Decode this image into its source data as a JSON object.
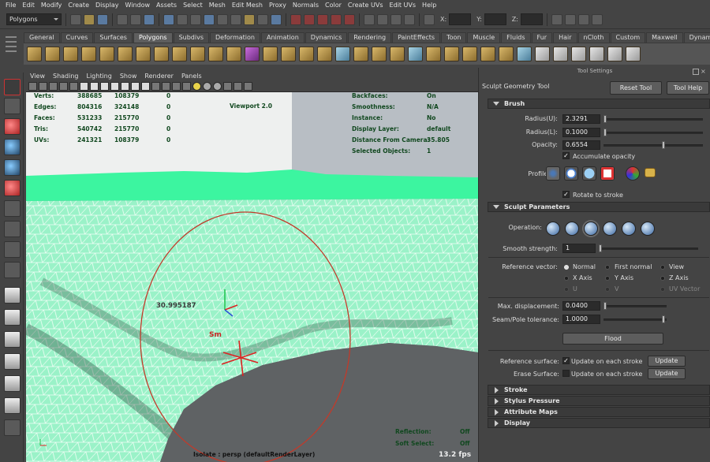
{
  "menubar": {
    "items": [
      "File",
      "Edit",
      "Modify",
      "Create",
      "Display",
      "Window",
      "Assets",
      "Select",
      "Mesh",
      "Edit Mesh",
      "Proxy",
      "Normals",
      "Color",
      "Create UVs",
      "Edit UVs",
      "Help"
    ]
  },
  "status_line": {
    "mode": "Polygons",
    "x_label": "X:",
    "y_label": "Y:",
    "z_label": "Z:"
  },
  "shelf": {
    "tabs": [
      "General",
      "Curves",
      "Surfaces",
      "Polygons",
      "Subdivs",
      "Deformation",
      "Animation",
      "Dynamics",
      "Rendering",
      "PaintEffects",
      "Toon",
      "Muscle",
      "Fluids",
      "Fur",
      "Hair",
      "nCloth",
      "Custom",
      "Maxwell",
      "Dynamica"
    ],
    "active_tab": "Polygons"
  },
  "viewport": {
    "menu": [
      "View",
      "Shading",
      "Lighting",
      "Show",
      "Renderer",
      "Panels"
    ],
    "hud_stats": [
      {
        "label": "Verts:",
        "v1": "388685",
        "v2": "108379",
        "v3": "0"
      },
      {
        "label": "Edges:",
        "v1": "804316",
        "v2": "324148",
        "v3": "0"
      },
      {
        "label": "Faces:",
        "v1": "531233",
        "v2": "215770",
        "v3": "0"
      },
      {
        "label": "Tris:",
        "v1": "540742",
        "v2": "215770",
        "v3": "0"
      },
      {
        "label": "UVs:",
        "v1": "241321",
        "v2": "108379",
        "v3": "0"
      }
    ],
    "renderer_label": "Viewport 2.0",
    "hud_right": [
      {
        "label": "Backfaces:",
        "value": "On"
      },
      {
        "label": "Smoothness:",
        "value": "N/A"
      },
      {
        "label": "Instance:",
        "value": "No"
      },
      {
        "label": "Display Layer:",
        "value": "default"
      },
      {
        "label": "Distance From Camera:",
        "value": "35.805"
      },
      {
        "label": "Selected Objects:",
        "value": "1"
      }
    ],
    "brush_value": "30.995187",
    "sm_label": "Sm",
    "hud_bottom": [
      {
        "label": "Reflection:",
        "value": "Off"
      },
      {
        "label": "Soft Select:",
        "value": "Off"
      }
    ],
    "isolate_label": "Isolate : persp (defaultRenderLayer)",
    "fps": "13.2 fps"
  },
  "tool_settings": {
    "panel_title": "Tool Settings",
    "tool_name": "Sculpt Geometry Tool",
    "reset_button": "Reset Tool",
    "help_button": "Tool Help",
    "brush_section": "Brush",
    "radius_u_label": "Radius(U):",
    "radius_u": "2.3291",
    "radius_l_label": "Radius(L):",
    "radius_l": "0.1000",
    "opacity_label": "Opacity:",
    "opacity": "0.6554",
    "accumulate_label": "Accumulate opacity",
    "profile_label": "Profile:",
    "rotate_label": "Rotate to stroke",
    "sculpt_section": "Sculpt Parameters",
    "operation_label": "Operation:",
    "smooth_label": "Smooth strength:",
    "smooth_value": "1",
    "ref_vector_label": "Reference vector:",
    "ref_options": [
      "Normal",
      "First normal",
      "View",
      "X Axis",
      "Y Axis",
      "Z Axis",
      "U",
      "V",
      "UV Vector"
    ],
    "max_disp_label": "Max. displacement:",
    "max_disp": "0.0400",
    "seam_label": "Seam/Pole tolerance:",
    "seam_value": "1.0000",
    "flood_button": "Flood",
    "ref_surface_label": "Reference surface:",
    "erase_surface_label": "Erase Surface:",
    "update_each_label": "Update on each stroke",
    "update_button": "Update",
    "collapsed_sections": [
      "Stroke",
      "Stylus Pressure",
      "Attribute Maps",
      "Display"
    ]
  }
}
